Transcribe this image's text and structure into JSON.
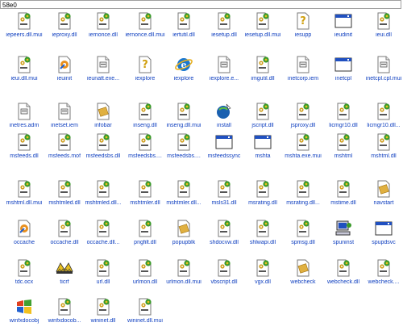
{
  "window": {
    "address": "58e0"
  },
  "files": [
    {
      "name": "iepeers.dll.mui",
      "icon": "dll-file-icon"
    },
    {
      "name": "ieproxy.dll",
      "icon": "dll-file-icon"
    },
    {
      "name": "iernonce.dll",
      "icon": "dll-file-icon"
    },
    {
      "name": "iernonce.dll.mui",
      "icon": "dll-file-icon"
    },
    {
      "name": "iertutil.dll",
      "icon": "dll-file-icon"
    },
    {
      "name": "iesetup.dll",
      "icon": "dll-file-icon"
    },
    {
      "name": "iesetup.dll.mui",
      "icon": "dll-file-icon"
    },
    {
      "name": "iesupp",
      "icon": "help-file-icon"
    },
    {
      "name": "ieudinit",
      "icon": "application-window-icon"
    },
    {
      "name": "ieui.dll",
      "icon": "dll-file-icon"
    },
    {
      "name": "ieui.dll.mui",
      "icon": "dll-file-icon"
    },
    {
      "name": "ieuinit",
      "icon": "setup-file-icon"
    },
    {
      "name": "ieunatt.exe...",
      "icon": "system-file-icon"
    },
    {
      "name": "iexplore",
      "icon": "help-file-icon"
    },
    {
      "name": "iexplore",
      "icon": "internet-explorer-icon"
    },
    {
      "name": "iexplore.e...",
      "icon": "system-file-icon"
    },
    {
      "name": "imgutil.dll",
      "icon": "dll-file-icon"
    },
    {
      "name": "inetcorp.iem",
      "icon": "system-file-icon"
    },
    {
      "name": "inetcpl",
      "icon": "application-window-icon"
    },
    {
      "name": "inetcpl.cpl.mui",
      "icon": "system-file-icon"
    },
    {
      "name": "inetres.adm",
      "icon": "system-file-icon"
    },
    {
      "name": "inetset.iem",
      "icon": "system-file-icon"
    },
    {
      "name": "infobar",
      "icon": "image-file-icon"
    },
    {
      "name": "inseng.dll",
      "icon": "dll-file-icon"
    },
    {
      "name": "inseng.dll.mui",
      "icon": "dll-file-icon"
    },
    {
      "name": "install",
      "icon": "install-icon"
    },
    {
      "name": "jscript.dll",
      "icon": "dll-file-icon"
    },
    {
      "name": "jsproxy.dll",
      "icon": "dll-file-icon"
    },
    {
      "name": "licmgr10.dll",
      "icon": "dll-file-icon"
    },
    {
      "name": "licmgr10.dll...",
      "icon": "dll-file-icon"
    },
    {
      "name": "msfeeds.dll",
      "icon": "dll-file-icon"
    },
    {
      "name": "msfeeds.mof",
      "icon": "dll-file-icon"
    },
    {
      "name": "msfeedsbs.dll",
      "icon": "dll-file-icon"
    },
    {
      "name": "msfeedsbs....",
      "icon": "dll-file-icon"
    },
    {
      "name": "msfeedsbs....",
      "icon": "dll-file-icon"
    },
    {
      "name": "msfeedssync",
      "icon": "application-window-icon"
    },
    {
      "name": "mshta",
      "icon": "application-window-icon"
    },
    {
      "name": "mshta.exe.mui",
      "icon": "dll-file-icon"
    },
    {
      "name": "mshtml",
      "icon": "dll-file-icon"
    },
    {
      "name": "mshtml.dll",
      "icon": "dll-file-icon"
    },
    {
      "name": "mshtml.dll.mui",
      "icon": "dll-file-icon"
    },
    {
      "name": "mshtmled.dll",
      "icon": "dll-file-icon"
    },
    {
      "name": "mshtmled.dll...",
      "icon": "dll-file-icon"
    },
    {
      "name": "mshtmler.dll",
      "icon": "dll-file-icon"
    },
    {
      "name": "mshtmler.dll...",
      "icon": "dll-file-icon"
    },
    {
      "name": "msls31.dll",
      "icon": "dll-file-icon"
    },
    {
      "name": "msrating.dll",
      "icon": "dll-file-icon"
    },
    {
      "name": "msrating.dll...",
      "icon": "dll-file-icon"
    },
    {
      "name": "mstime.dll",
      "icon": "dll-file-icon"
    },
    {
      "name": "navstart",
      "icon": "image-file-icon"
    },
    {
      "name": "occache",
      "icon": "setup-file-icon"
    },
    {
      "name": "occache.dll",
      "icon": "dll-file-icon"
    },
    {
      "name": "occache.dll...",
      "icon": "dll-file-icon"
    },
    {
      "name": "pngfilt.dll",
      "icon": "dll-file-icon"
    },
    {
      "name": "popupblk",
      "icon": "image-file-icon"
    },
    {
      "name": "shdocvw.dll",
      "icon": "dll-file-icon"
    },
    {
      "name": "shlwapi.dll",
      "icon": "dll-file-icon"
    },
    {
      "name": "spmsg.dll",
      "icon": "dll-file-icon"
    },
    {
      "name": "spuninst",
      "icon": "computer-icon"
    },
    {
      "name": "spupdsvc",
      "icon": "application-window-icon"
    },
    {
      "name": "tdc.ocx",
      "icon": "dll-file-icon"
    },
    {
      "name": "ticrf",
      "icon": "ticrf-icon"
    },
    {
      "name": "url.dll",
      "icon": "dll-file-icon"
    },
    {
      "name": "urlmon.dll",
      "icon": "dll-file-icon"
    },
    {
      "name": "urlmon.dll.mui",
      "icon": "dll-file-icon"
    },
    {
      "name": "vbscript.dll",
      "icon": "dll-file-icon"
    },
    {
      "name": "vgx.dll",
      "icon": "dll-file-icon"
    },
    {
      "name": "webcheck",
      "icon": "image-file-icon"
    },
    {
      "name": "webcheck.dll",
      "icon": "dll-file-icon"
    },
    {
      "name": "webcheck....",
      "icon": "dll-file-icon"
    },
    {
      "name": "winfxdocobj",
      "icon": "windows-logo-icon"
    },
    {
      "name": "winfxdocob...",
      "icon": "dll-file-icon"
    },
    {
      "name": "wininet.dll",
      "icon": "dll-file-icon"
    },
    {
      "name": "wininet.dll.mui",
      "icon": "dll-file-icon"
    }
  ],
  "colors": {
    "label": "#1040c0",
    "gear_green": "#3a9a2a",
    "gear_yellow": "#e8c020"
  }
}
